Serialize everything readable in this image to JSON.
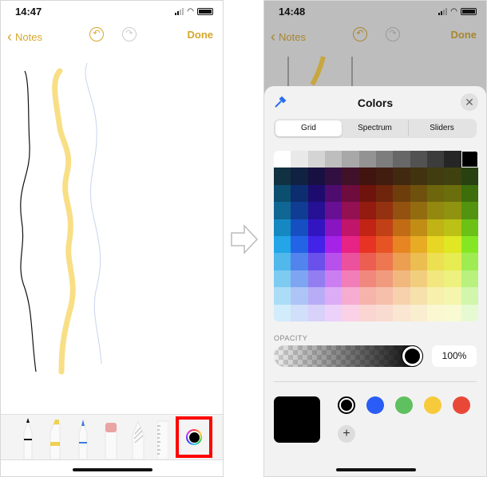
{
  "left": {
    "time": "14:47",
    "back_label": "Notes",
    "done_label": "Done",
    "undo_icon": "undo-icon",
    "redo_icon": "redo-icon",
    "tools": [
      "pen",
      "marker",
      "pencil",
      "eraser",
      "lasso",
      "ruler"
    ],
    "color_button_highlight": "#ff0000"
  },
  "right": {
    "time": "14:48",
    "back_label": "Notes",
    "done_label": "Done",
    "colors_panel": {
      "title": "Colors",
      "tabs": [
        {
          "label": "Grid",
          "selected": true
        },
        {
          "label": "Spectrum",
          "selected": false
        },
        {
          "label": "Sliders",
          "selected": false
        }
      ],
      "grid_column_hues": [
        200,
        220,
        250,
        280,
        330,
        5,
        15,
        30,
        42,
        55,
        62,
        90
      ],
      "opacity_label": "OPACITY",
      "opacity_value": "100%",
      "opacity": 1.0,
      "current_color": "#000000",
      "swatches": [
        "#000000",
        "#2a5cf6",
        "#5fc05f",
        "#f7ca3c",
        "#e94838"
      ],
      "selected_swatch": 0
    }
  },
  "accent": "#d4a72c"
}
